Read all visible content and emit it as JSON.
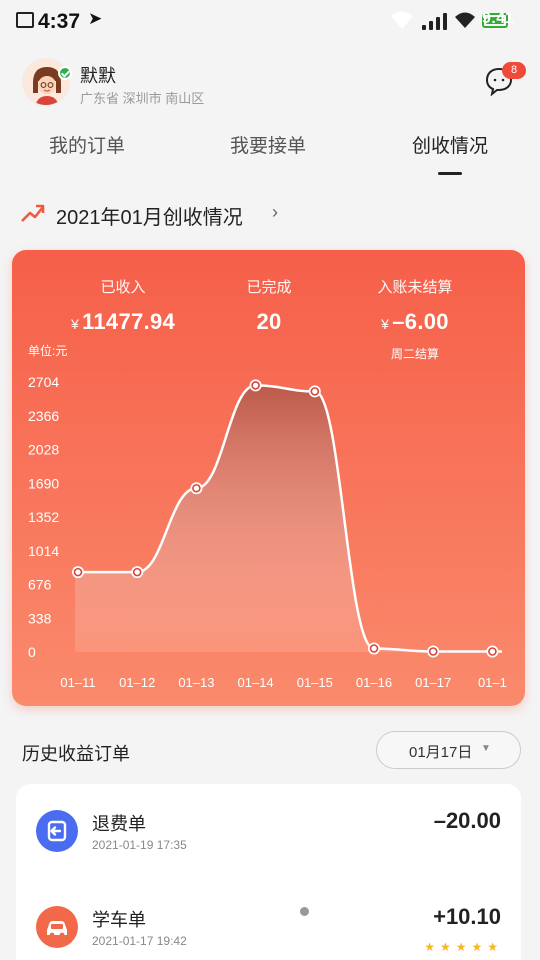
{
  "status_bar": {
    "time": "4:37",
    "battery": "9:41"
  },
  "header": {
    "user_name": "默默",
    "location": "广东省 深圳市 南山区",
    "message_count": "8"
  },
  "tabs": [
    {
      "label": "我的订单",
      "active": false
    },
    {
      "label": "我要接单",
      "active": false
    },
    {
      "label": "创收情况",
      "active": true
    }
  ],
  "month": {
    "title": "2021年01月创收情况",
    "chevron": "›"
  },
  "summary": {
    "received_label": "已收入",
    "received_value": "11477.94",
    "currency": "¥",
    "completed_label": "已完成",
    "completed_value": "20",
    "pending_label": "入账未结算",
    "pending_value": "–6.00",
    "settle_note": "周二结算",
    "unit_label": "单位:元"
  },
  "chart_data": {
    "type": "area",
    "categories": [
      "01–11",
      "01–12",
      "01–13",
      "01–14",
      "01–15",
      "01–16",
      "01–17",
      "01–1"
    ],
    "values": [
      800,
      800,
      1640,
      2670,
      2610,
      35,
      5,
      5
    ],
    "y_ticks": [
      0,
      338,
      676,
      1014,
      1352,
      1690,
      2028,
      2366,
      2704
    ],
    "ylim": [
      0,
      2704
    ],
    "grid": false,
    "colors": {
      "line": "#ffffff",
      "fill": "#b85a4e",
      "marker": "#d9453a"
    }
  },
  "history": {
    "title": "历史收益订单",
    "filter_label": "01月17日",
    "filter_caret": "▼"
  },
  "orders": [
    {
      "title": "退费单",
      "time": "2021-01-19 17:35",
      "amount": "–20.00",
      "icon": "refund-icon",
      "icon_color": "#4a6cf0",
      "stars": ""
    },
    {
      "title": "学车单",
      "time": "2021-01-17 19:42",
      "amount": "+10.10",
      "icon": "car-icon",
      "icon_color": "#f2694a",
      "stars": "★★★★★"
    }
  ]
}
